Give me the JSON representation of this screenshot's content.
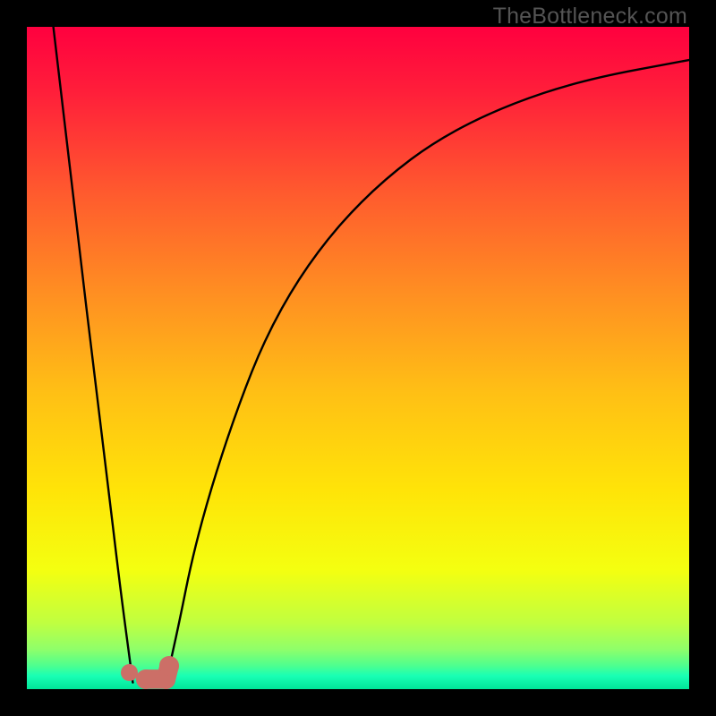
{
  "watermark": "TheBottleneck.com",
  "colors": {
    "frame": "#000000",
    "curve": "#000000",
    "marker": "#cc6f67",
    "gradient_stops": [
      {
        "offset": 0.0,
        "color": "#ff003f"
      },
      {
        "offset": 0.1,
        "color": "#ff1f3a"
      },
      {
        "offset": 0.25,
        "color": "#ff5a2e"
      },
      {
        "offset": 0.4,
        "color": "#ff8e22"
      },
      {
        "offset": 0.55,
        "color": "#ffbf15"
      },
      {
        "offset": 0.7,
        "color": "#ffe408"
      },
      {
        "offset": 0.82,
        "color": "#f4ff10"
      },
      {
        "offset": 0.9,
        "color": "#c0ff40"
      },
      {
        "offset": 0.94,
        "color": "#8fff6a"
      },
      {
        "offset": 0.965,
        "color": "#4cff90"
      },
      {
        "offset": 0.98,
        "color": "#19ffb5"
      },
      {
        "offset": 1.0,
        "color": "#00e598"
      }
    ]
  },
  "chart_data": {
    "type": "line",
    "title": "",
    "xlabel": "",
    "ylabel": "",
    "xlim": [
      0,
      100
    ],
    "ylim": [
      0,
      100
    ],
    "grid": false,
    "series": [
      {
        "name": "left-branch",
        "x": [
          4,
          6,
          8,
          10,
          12,
          14,
          16
        ],
        "y": [
          100,
          83,
          66,
          49,
          33,
          16,
          1
        ]
      },
      {
        "name": "right-branch",
        "x": [
          21,
          23,
          25,
          28,
          32,
          36,
          41,
          47,
          54,
          62,
          72,
          84,
          100
        ],
        "y": [
          1,
          10,
          20,
          31,
          43,
          53,
          62,
          70,
          77,
          83,
          88,
          92,
          95
        ]
      }
    ],
    "markers": [
      {
        "name": "marker-dot",
        "x": 15.5,
        "y": 2.5,
        "r": 1.3
      },
      {
        "name": "marker-pill-left",
        "x": 18.0,
        "y": 1.5,
        "r": 1.45
      },
      {
        "name": "marker-pill-right",
        "x": 21.0,
        "y": 1.5,
        "r": 1.45
      },
      {
        "name": "marker-pill-tip",
        "x": 21.5,
        "y": 3.5,
        "r": 1.45
      }
    ],
    "annotations": []
  }
}
